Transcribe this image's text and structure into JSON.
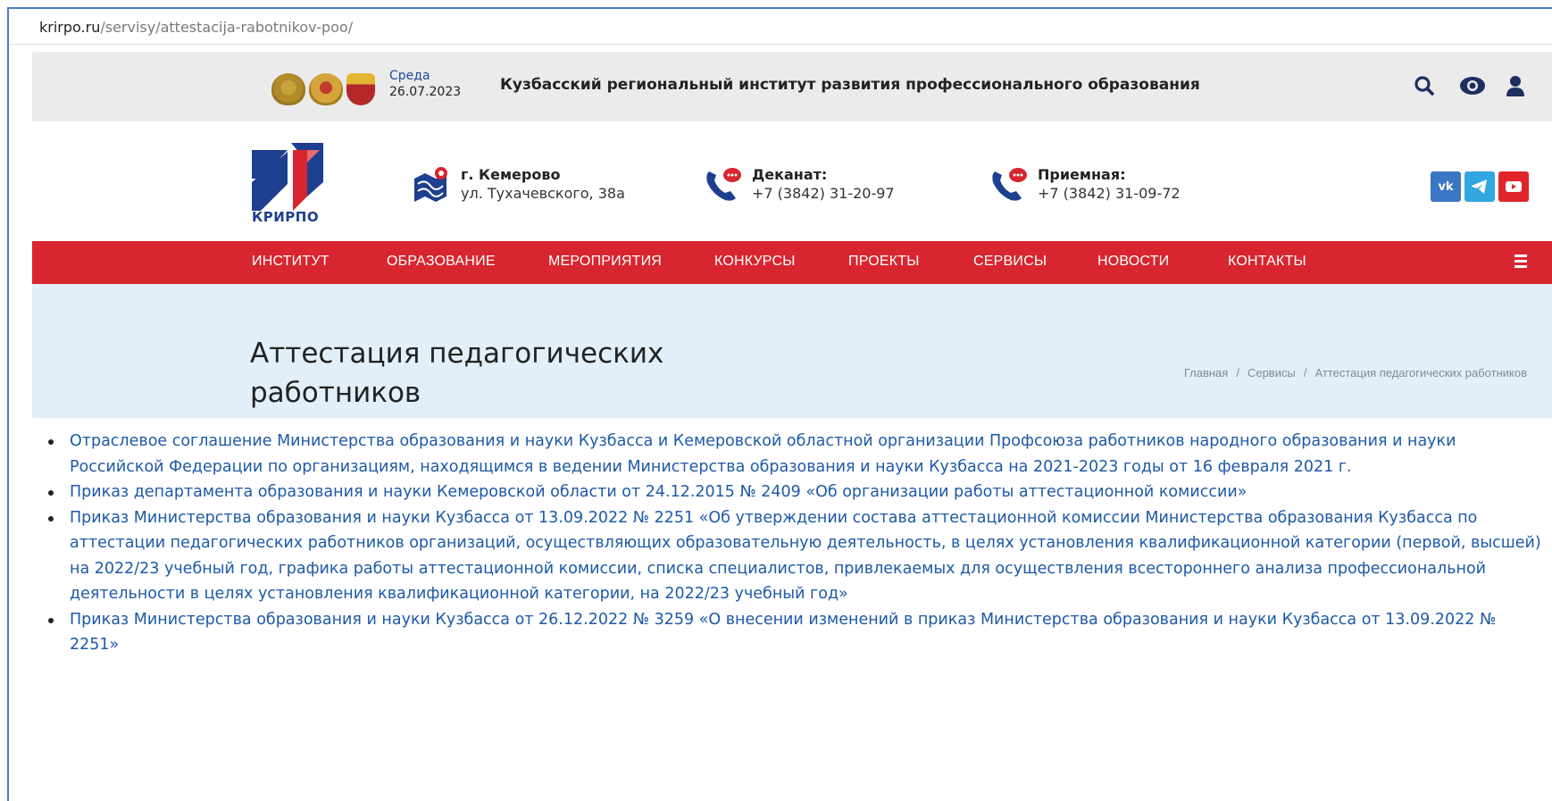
{
  "browser": {
    "url_host": "krirpo.ru",
    "url_path": "/servisy/attestacija-rabotnikov-poo/"
  },
  "topbar": {
    "day": "Среда",
    "date": "26.07.2023",
    "site_title": "Кузбасский региональный институт развития профессионального образования",
    "icons": [
      "search-icon",
      "eye-icon",
      "user-icon"
    ]
  },
  "header": {
    "logo_text": "КРИРПО",
    "address_title": "г. Кемерово",
    "address_sub": "ул. Тухачевского, 38а",
    "dean_title": "Деканат:",
    "dean_phone": "+7 (3842) 31-20-97",
    "reception_title": "Приемная:",
    "reception_phone": "+7 (3842) 31-09-72",
    "socials": [
      "vk",
      "telegram",
      "youtube"
    ],
    "vk_label": "vk"
  },
  "nav": {
    "items": [
      "ИНСТИТУТ",
      "ОБРАЗОВАНИЕ",
      "МЕРОПРИЯТИЯ",
      "КОНКУРСЫ",
      "ПРОЕКТЫ",
      "СЕРВИСЫ",
      "НОВОСТИ",
      "КОНТАКТЫ"
    ]
  },
  "page": {
    "title": "Аттестация педагогических работников",
    "breadcrumb": [
      "Главная",
      "/",
      "Сервисы",
      "/",
      "Аттестация педагогических работников"
    ]
  },
  "documents": [
    "Отраслевое соглашение Министерства образования и науки Кузбасса и Кемеровской областной организации Профсоюза работников народного образования и науки Российской Федерации по организациям, находящимся в ведении Министерства образования и науки Кузбасса на 2021-2023 годы от 16 февраля 2021 г.",
    "Приказ департамента образования и науки Кемеровской области от 24.12.2015 № 2409 «Об организации работы аттестационной комиссии»",
    "Приказ Министерства образования и науки Кузбасса от 13.09.2022 № 2251 «Об утверждении состава аттестационной комиссии Министерства образования Кузбасса по аттестации педагогических работников организаций, осуществляющих образовательную деятельность, в целях установления квалификационной категории (первой, высшей) на 2022/23 учебный год, графика работы аттестационной комиссии, списка специалистов, привлекаемых для осуществления всестороннего анализа профессиональной деятельности в целях установления квалификационной категории, на 2022/23 учебный год»",
    "Приказ Министерства образования и науки Кузбасса от 26.12.2022 № 3259 «О внесении изменений в приказ Министерства образования и науки Кузбасса от 13.09.2022 № 2251»"
  ],
  "colors": {
    "nav_red": "#d7262f",
    "link_blue": "#1e59a8",
    "hero_bg": "#e2eff9",
    "brand_blue": "#1d3f8f"
  }
}
